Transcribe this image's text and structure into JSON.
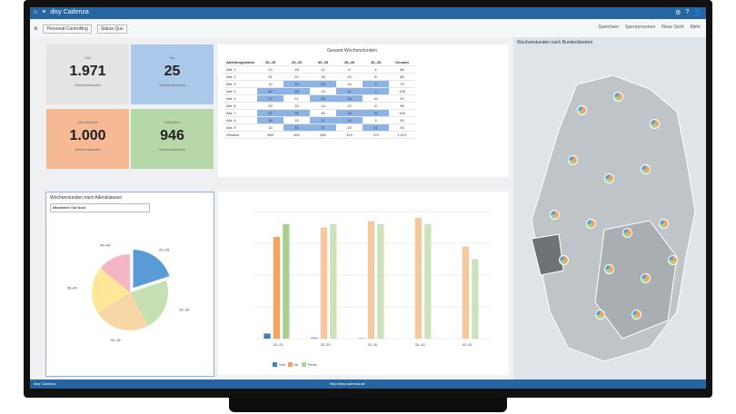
{
  "app": {
    "title": "disy Cadenza"
  },
  "toolbar": {
    "items": [
      "Personal-Controlling",
      "Status Quo"
    ],
    "actions": [
      "Speichern",
      "Sperrpersonen",
      "Neue Sicht",
      "Mehr"
    ]
  },
  "kpis": [
    {
      "label": "Soll",
      "value": "1.971",
      "sub": "Wochenstunden",
      "color": "#e4e4e4"
    },
    {
      "label": "Ist",
      "value": "25",
      "sub": "Wochenstunden",
      "color": "#a9c8ea"
    },
    {
      "label": "Überstunden",
      "value": "1.000",
      "sub": "Wochenstunden",
      "color": "#f5b994"
    },
    {
      "label": "Fehlzeiten",
      "value": "946",
      "sub": "Wochenstunden",
      "color": "#b6d7a8"
    }
  ],
  "pivot": {
    "title": "Gesamt Wochenstunden",
    "columns": [
      "Abteilungsname",
      "20–25",
      "25–30",
      "30–35",
      "35–40",
      "40–45",
      "Gesamt"
    ],
    "rows": [
      [
        "Abt. 1",
        "24",
        "18",
        "12",
        "8",
        "4",
        "66"
      ],
      [
        "Abt. 2",
        "31",
        "22",
        "16",
        "10",
        "6",
        "85"
      ],
      [
        "Abt. 3",
        "12",
        "15",
        "20",
        "14",
        "9",
        "70"
      ],
      [
        "Abt. 4",
        "40",
        "28",
        "19",
        "11",
        "7",
        "105"
      ],
      [
        "Abt. 5",
        "17",
        "21",
        "25",
        "18",
        "10",
        "91"
      ],
      [
        "Abt. 6",
        "29",
        "33",
        "14",
        "12",
        "8",
        "96"
      ],
      [
        "Abt. 7",
        "22",
        "26",
        "30",
        "16",
        "11",
        "105"
      ],
      [
        "Abt. 8",
        "35",
        "19",
        "17",
        "13",
        "9",
        "93"
      ],
      [
        "Abt. 9",
        "15",
        "24",
        "21",
        "20",
        "12",
        "92"
      ],
      [
        "Gesamt",
        "380",
        "420",
        "390",
        "310",
        "170",
        "1.670"
      ]
    ]
  },
  "pie_panel": {
    "title": "Wochenstunden nach Altersklassen",
    "filter": "Mitarbeiter Ost Nord",
    "chart_data": {
      "type": "pie",
      "labels": [
        "20–25",
        "25–30",
        "30–35",
        "35–40",
        "40–45"
      ],
      "values": [
        20,
        22,
        24,
        20,
        14
      ],
      "colors": [
        "#5b9bd5",
        "#c6e0b4",
        "#f8d7a7",
        "#ffe699",
        "#f4b6c2"
      ]
    }
  },
  "bar_chart": {
    "chart_data": {
      "type": "bar",
      "categories": [
        "20–25",
        "25–30",
        "30–35",
        "35–40",
        "40–45"
      ],
      "series": [
        {
          "name": "Soll",
          "values": [
            8,
            2,
            1,
            0,
            0
          ],
          "color": "#3d7ec9"
        },
        {
          "name": "Ist",
          "values": [
            160,
            175,
            185,
            190,
            145
          ],
          "color": "#f5a25d"
        },
        {
          "name": "Fehlz.",
          "values": [
            180,
            180,
            180,
            180,
            125
          ],
          "color": "#a9d18e"
        }
      ],
      "ylim": [
        0,
        200
      ]
    }
  },
  "map": {
    "title": "Wochenstunden nach Bundesländern"
  },
  "status": {
    "left": "disy Cadenza",
    "center": "http://disy.cadenza.de"
  }
}
